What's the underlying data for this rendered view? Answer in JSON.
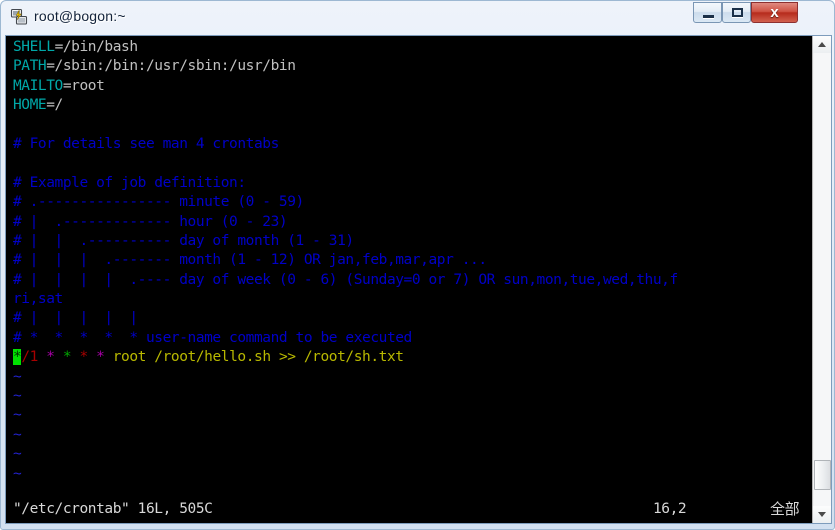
{
  "window": {
    "title": "root@bogon:~",
    "icon": "putty-terminal-icon",
    "controls": {
      "minimize_label": "─",
      "maximize_label": "□",
      "close_label": "x"
    }
  },
  "terminal": {
    "editor": "vi",
    "colors": {
      "background": "#000000",
      "variable": "#00a8a8",
      "value": "#c0c0c0",
      "comment": "#0000c8",
      "tilde": "#2222cc",
      "command": "#b8b800",
      "cursor": "#00e000",
      "status": "#d8d8d8"
    },
    "lines": [
      {
        "id": "shell",
        "segments": [
          {
            "text": "SHELL",
            "color": "cyan"
          },
          {
            "text": "=/bin/bash",
            "color": "white"
          }
        ]
      },
      {
        "id": "path",
        "segments": [
          {
            "text": "PATH",
            "color": "cyan"
          },
          {
            "text": "=/sbin:/bin:/usr/sbin:/usr/bin",
            "color": "white"
          }
        ]
      },
      {
        "id": "mailto",
        "segments": [
          {
            "text": "MAILTO",
            "color": "cyan"
          },
          {
            "text": "=root",
            "color": "white"
          }
        ]
      },
      {
        "id": "home",
        "segments": [
          {
            "text": "HOME",
            "color": "cyan"
          },
          {
            "text": "=/",
            "color": "white"
          }
        ]
      },
      {
        "id": "blank1",
        "segments": [
          {
            "text": "",
            "color": "white"
          }
        ]
      },
      {
        "id": "comment-details",
        "segments": [
          {
            "text": "# For details see man 4 crontabs",
            "color": "blue"
          }
        ]
      },
      {
        "id": "blank2",
        "segments": [
          {
            "text": "",
            "color": "white"
          }
        ]
      },
      {
        "id": "comment-example",
        "segments": [
          {
            "text": "# Example of job definition:",
            "color": "blue"
          }
        ]
      },
      {
        "id": "comment-minute",
        "segments": [
          {
            "text": "# .---------------- minute (0 - 59)",
            "color": "blue"
          }
        ]
      },
      {
        "id": "comment-hour",
        "segments": [
          {
            "text": "# |  .------------- hour (0 - 23)",
            "color": "blue"
          }
        ]
      },
      {
        "id": "comment-dom",
        "segments": [
          {
            "text": "# |  |  .---------- day of month (1 - 31)",
            "color": "blue"
          }
        ]
      },
      {
        "id": "comment-month",
        "segments": [
          {
            "text": "# |  |  |  .------- month (1 - 12) OR jan,feb,mar,apr ...",
            "color": "blue"
          }
        ]
      },
      {
        "id": "comment-dow",
        "segments": [
          {
            "text": "# |  |  |  |  .---- day of week (0 - 6) (Sunday=0 or 7) OR sun,mon,tue,wed,thu,f",
            "color": "blue"
          }
        ]
      },
      {
        "id": "comment-dow-wrap",
        "segments": [
          {
            "text": "ri,sat",
            "color": "blue"
          }
        ]
      },
      {
        "id": "comment-bars",
        "segments": [
          {
            "text": "# |  |  |  |  |",
            "color": "blue"
          }
        ]
      },
      {
        "id": "comment-header",
        "segments": [
          {
            "text": "# *  *  *  *  * user-name command to be executed",
            "color": "blue"
          }
        ]
      },
      {
        "id": "cron-entry",
        "segments": [
          {
            "text": "*",
            "color": "cursor"
          },
          {
            "text": "/1",
            "color": "red"
          },
          {
            "text": " ",
            "color": "white"
          },
          {
            "text": "*",
            "color": "mag"
          },
          {
            "text": " ",
            "color": "white"
          },
          {
            "text": "*",
            "color": "green"
          },
          {
            "text": " ",
            "color": "white"
          },
          {
            "text": "*",
            "color": "red"
          },
          {
            "text": " ",
            "color": "white"
          },
          {
            "text": "*",
            "color": "mag"
          },
          {
            "text": " root /root/hello.sh >> /root/sh.txt",
            "color": "yellow"
          }
        ]
      },
      {
        "id": "tilde1",
        "segments": [
          {
            "text": "~",
            "color": "tilde"
          }
        ]
      },
      {
        "id": "tilde2",
        "segments": [
          {
            "text": "~",
            "color": "tilde"
          }
        ]
      },
      {
        "id": "tilde3",
        "segments": [
          {
            "text": "~",
            "color": "tilde"
          }
        ]
      },
      {
        "id": "tilde4",
        "segments": [
          {
            "text": "~",
            "color": "tilde"
          }
        ]
      },
      {
        "id": "tilde5",
        "segments": [
          {
            "text": "~",
            "color": "tilde"
          }
        ]
      },
      {
        "id": "tilde6",
        "segments": [
          {
            "text": "~",
            "color": "tilde"
          }
        ]
      }
    ],
    "status": {
      "file_info": "\"/etc/crontab\" 16L, 505C",
      "position": "16,2",
      "scroll_indicator": "全部"
    }
  },
  "scrollbar": {
    "up_arrow": "scroll-up",
    "down_arrow": "scroll-down",
    "thumb": "scroll-thumb"
  }
}
